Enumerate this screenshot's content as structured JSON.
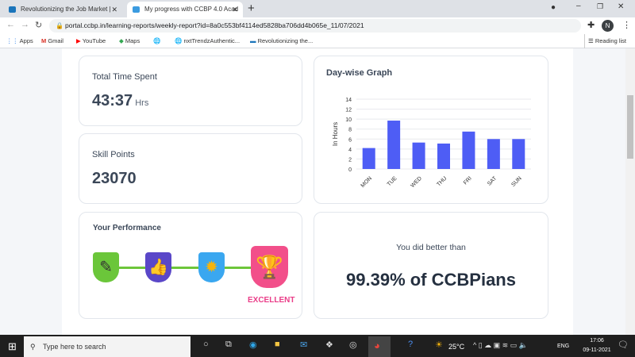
{
  "browser": {
    "tabs": [
      {
        "title": "Revolutionizing the Job Market |"
      },
      {
        "title": "My progress with CCBP 4.0 Acad"
      }
    ],
    "url": "portal.ccbp.in/learning-reports/weekly-report?id=8a0c553bf4114ed5828ba706dd4b065e_11/07/2021",
    "bookmarks": [
      "Apps",
      "Gmail",
      "YouTube",
      "Maps",
      "nxtTrendzAuthentic...",
      "Revolutionizing the..."
    ],
    "reading_list": "Reading list",
    "profile": "N"
  },
  "cards": {
    "time": {
      "label": "Total Time Spent",
      "value": "43:37",
      "unit": "Hrs"
    },
    "skill": {
      "label": "Skill Points",
      "value": "23070"
    },
    "performance": {
      "title": "Your Performance",
      "level": "EXCELLENT"
    },
    "rank": {
      "text": "You did better than",
      "value": "99.39% of CCBPians"
    }
  },
  "chart_data": {
    "type": "bar",
    "title": "Day-wise Graph",
    "xlabel": "",
    "ylabel": "In Hours",
    "categories": [
      "MON",
      "TUE",
      "WED",
      "THU",
      "FRI",
      "SAT",
      "SUN"
    ],
    "values": [
      4.2,
      9.7,
      5.3,
      5.1,
      7.5,
      6.0,
      6.0
    ],
    "ylim": [
      0,
      14
    ],
    "yticks": [
      "0",
      "2",
      "4",
      "6",
      "8",
      "10",
      "12",
      "14"
    ],
    "color": "#4e5df5",
    "grid": true
  },
  "taskbar": {
    "search_placeholder": "Type here to search",
    "weather": "25°C",
    "lang": "ENG",
    "time": "17:06",
    "date": "09-11-2021"
  }
}
